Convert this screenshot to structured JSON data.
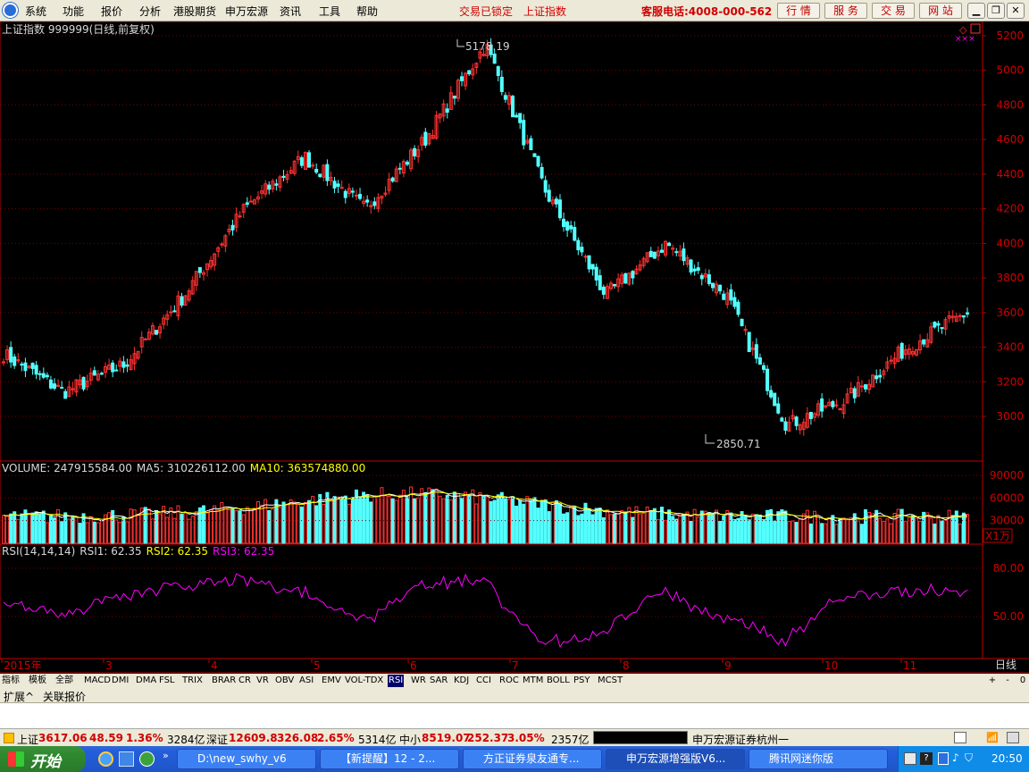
{
  "menu": {
    "items": [
      "系统",
      "功能",
      "报价",
      "分析",
      "港股期货",
      "申万宏源",
      "资讯",
      "工具",
      "帮助"
    ],
    "trade_lock": "交易已锁定",
    "index_name": "上证指数",
    "hotline": "客服电话:4008-000-562",
    "buttons": [
      "行 情",
      "服 务",
      "交 易",
      "网 站"
    ]
  },
  "chart_header": {
    "title": "上证指数 999999(日线,前复权)"
  },
  "chart_data": {
    "type": "candlestick",
    "series_name": "上证指数",
    "period": "日线",
    "adjust": "前复权",
    "candles_visible": 266,
    "high_annotation": "5178.19",
    "low_annotation": "2850.71",
    "ylim": [
      2850,
      5200
    ],
    "yticks": [
      "5200",
      "5000",
      "4800",
      "4600",
      "4400",
      "4200",
      "4000",
      "3800",
      "3600",
      "3400",
      "3200",
      "3000"
    ],
    "approx_close_path": [
      {
        "d": "2015-02",
        "close": 3360
      },
      {
        "d": "2015-02",
        "close": 3140
      },
      {
        "d": "2015-03",
        "close": 3300
      },
      {
        "d": "2015-03",
        "close": 3700
      },
      {
        "d": "2015-04",
        "close": 4200
      },
      {
        "d": "2015-04",
        "close": 4500
      },
      {
        "d": "2015-05",
        "close": 4200
      },
      {
        "d": "2015-05",
        "close": 4600
      },
      {
        "d": "2015-06",
        "close": 5150
      },
      {
        "d": "2015-06",
        "close": 4300
      },
      {
        "d": "2015-07",
        "close": 3700
      },
      {
        "d": "2015-07",
        "close": 4000
      },
      {
        "d": "2015-08",
        "close": 3700
      },
      {
        "d": "2015-08",
        "close": 2950
      },
      {
        "d": "2015-09",
        "close": 3100
      },
      {
        "d": "2015-10",
        "close": 3400
      },
      {
        "d": "2015-11",
        "close": 3600
      }
    ],
    "volume": {
      "label": "VOLUME: 247915584.00",
      "ma5": "MA5: 310226112.00",
      "ma10": "MA10: 363574880.00",
      "yticks": [
        "90000",
        "60000",
        "30000"
      ],
      "unit": "X1万"
    },
    "rsi": {
      "label": "RSI(14,14,14)",
      "rsi1": "RSI1: 62.35",
      "rsi2": "RSI2: 62.35",
      "rsi3": "RSI3: 62.35",
      "yticks": [
        "80.00",
        "50.00"
      ]
    },
    "xaxis": [
      "2015年",
      "3",
      "4",
      "5",
      "6",
      "7",
      "8",
      "9",
      "10",
      "11"
    ],
    "xaxis_right": "日线"
  },
  "indicator_tabs": [
    "指标",
    "模板",
    "全部",
    "MACD",
    "DMI",
    "DMA",
    "FSL",
    "TRIX",
    "BRAR",
    "CR",
    "VR",
    "OBV",
    "ASI",
    "EMV",
    "VOL-TDX",
    "RSI",
    "WR",
    "SAR",
    "KDJ",
    "CCI",
    "ROC",
    "MTM",
    "BOLL",
    "PSY",
    "MCST"
  ],
  "active_tab": "RSI",
  "tab_controls": [
    "+",
    "-",
    "0"
  ],
  "sub_tabs": [
    "扩展^",
    "关联报价"
  ],
  "status": {
    "sh_label": "上证",
    "sh_val": "3617.06",
    "sh_chg": "48.59",
    "sh_pct": "1.36%",
    "sh_amt": "3284亿",
    "sz_label": "深证",
    "sz_val": "12609.8",
    "sz_chg": "326.08",
    "sz_pct": "2.65%",
    "sz_amt": "5314亿",
    "zx_label": "中小",
    "zx_val": "8519.07",
    "zx_chg": "252.37",
    "zx_pct": "3.05%",
    "zx_amt": "2357亿",
    "broker": "申万宏源证券杭州一"
  },
  "taskbar": {
    "start": "开始",
    "tasks": [
      "D:\\new_swhy_v6",
      "【新提醒】12 - 2...",
      "方正证券泉友通专...",
      "申万宏源增强版V6...",
      "腾讯网迷你版"
    ],
    "time": "20:50"
  },
  "colors": {
    "up": "#ff3232",
    "down": "#54ffff",
    "axis": "#c00000",
    "rsi": "#ff00ff",
    "ma5": "#ffffff",
    "ma10": "#ffff00",
    "label_red": "#d00000"
  }
}
